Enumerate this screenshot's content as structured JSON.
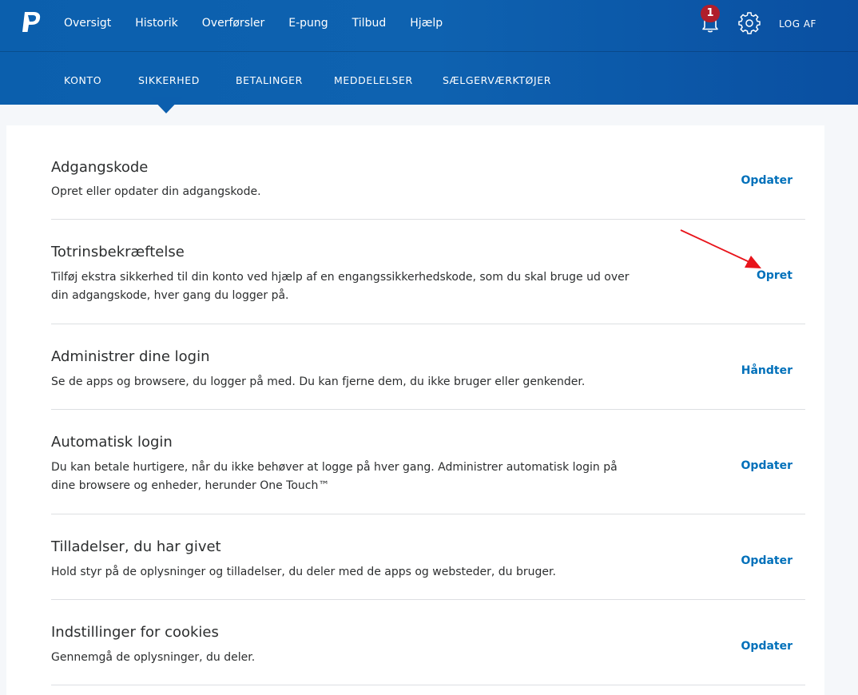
{
  "header": {
    "logo_icon": "paypal-logo-icon",
    "nav": [
      "Oversigt",
      "Historik",
      "Overførsler",
      "E-pung",
      "Tilbud",
      "Hjælp"
    ],
    "notification_count": "1",
    "logout_label": "LOG AF",
    "icons": [
      "bell-icon",
      "gear-icon"
    ]
  },
  "subnav": {
    "items": [
      "KONTO",
      "SIKKERHED",
      "BETALINGER",
      "MEDDELELSER",
      "SÆLGERVÆRKTØJER"
    ],
    "active": "SIKKERHED"
  },
  "settings": [
    {
      "title": "Adgangskode",
      "description": "Opret eller opdater din adgangskode.",
      "action": "Opdater"
    },
    {
      "title": "Totrinsbekræftelse",
      "description": "Tilføj ekstra sikkerhed til din konto ved hjælp af en engangssikkerhedskode, som du skal bruge ud over din adgangskode, hver gang du logger på.",
      "action": "Opret"
    },
    {
      "title": "Administrer dine login",
      "description": "Se de apps og browsere, du logger på med. Du kan fjerne dem, du ikke bruger eller genkender.",
      "action": "Håndter"
    },
    {
      "title": "Automatisk login",
      "description": "Du kan betale hurtigere, når du ikke behøver at logge på hver gang. Administrer automatisk login på dine browsere og enheder, herunder One Touch™",
      "action": "Opdater"
    },
    {
      "title": "Tilladelser, du har givet",
      "description": "Hold styr på de oplysninger og tilladelser, du deler med de apps og websteder, du bruger.",
      "action": "Opdater"
    },
    {
      "title": "Indstillinger for cookies",
      "description": "Gennemgå de oplysninger, du deler.",
      "action": "Opdater"
    }
  ],
  "annotation": {
    "icon": "red-arrow-icon",
    "color": "#e8141b"
  },
  "colors": {
    "header": "#0d5fae",
    "link": "#0070ba",
    "badge": "#b01e2b"
  }
}
